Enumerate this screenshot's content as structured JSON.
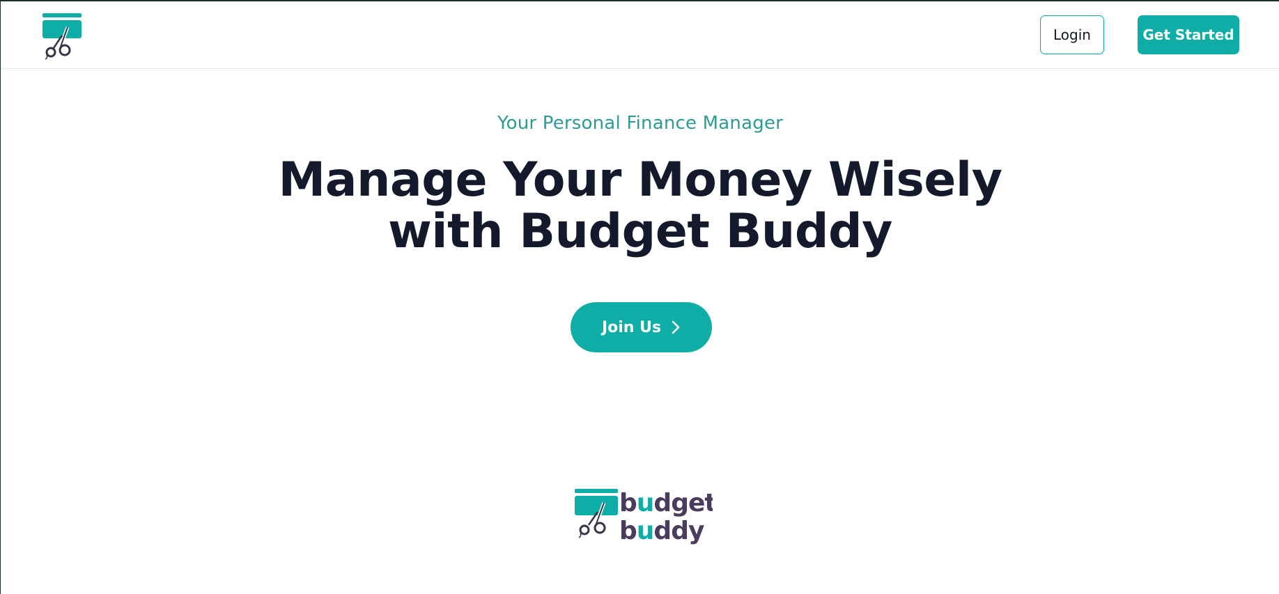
{
  "header": {
    "login_label": "Login",
    "get_started_label": "Get Started",
    "logo_icon": "credit-card-scissors-icon"
  },
  "hero": {
    "tagline": "Your Personal Finance Manager",
    "headline_line1": "Manage Your Money Wisely",
    "headline_line2": "with Budget Buddy",
    "join_label": "Join Us",
    "join_icon": "chevron-right-icon"
  },
  "brand_logo": {
    "word1": "budget",
    "word2": "buddy"
  },
  "colors": {
    "accent": "#0eaea6",
    "tagline": "#2e9a96",
    "heading": "#141a2b",
    "logo_purple": "#4b3b5c"
  }
}
